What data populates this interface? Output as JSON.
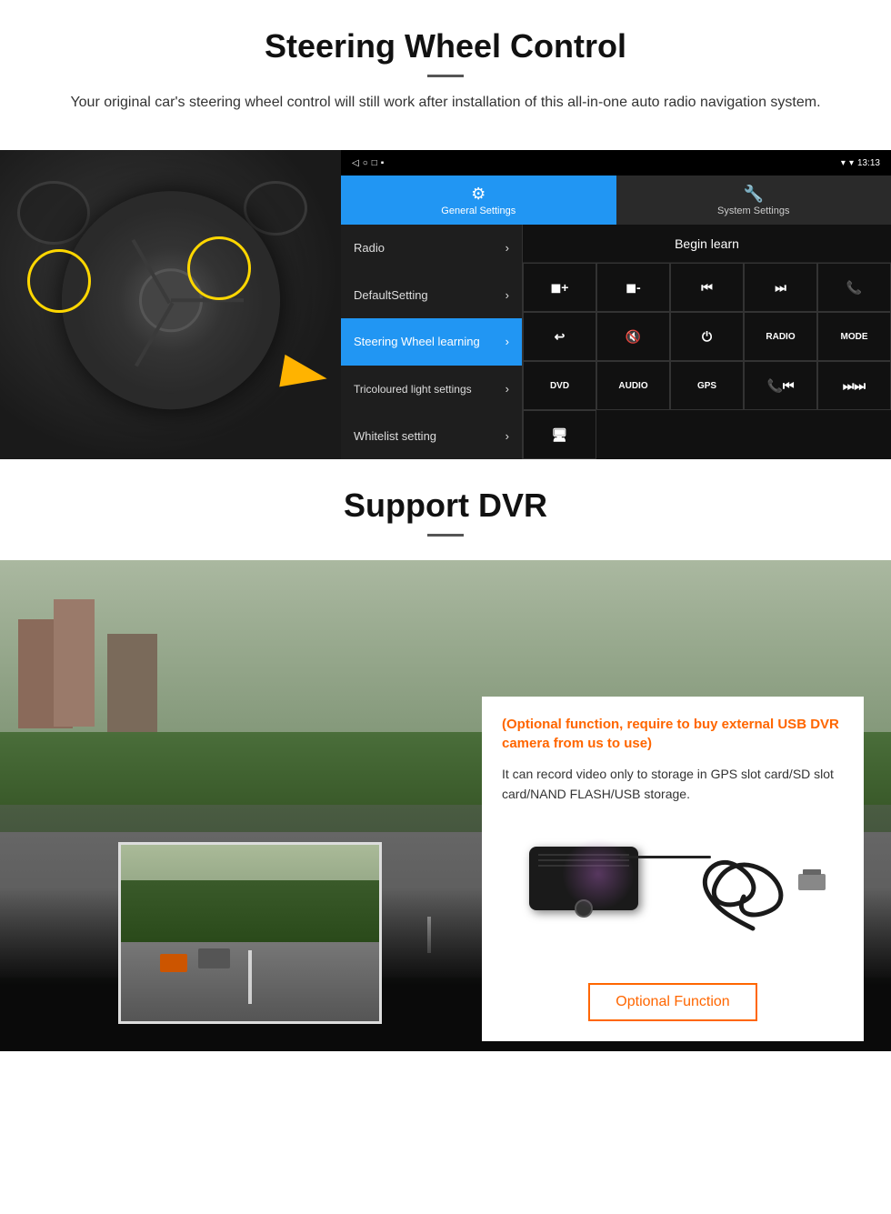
{
  "steering": {
    "title": "Steering Wheel Control",
    "subtitle": "Your original car's steering wheel control will still work after installation of this all-in-one auto radio navigation system.",
    "tabs": [
      {
        "label": "General Settings",
        "icon": "⚙"
      },
      {
        "label": "System Settings",
        "icon": "🔧"
      }
    ],
    "menu_items": [
      {
        "label": "Radio",
        "active": false
      },
      {
        "label": "DefaultSetting",
        "active": false
      },
      {
        "label": "Steering Wheel learning",
        "active": true
      },
      {
        "label": "Tricoloured light settings",
        "active": false
      },
      {
        "label": "Whitelist setting",
        "active": false
      }
    ],
    "begin_learn_label": "Begin learn",
    "status_time": "13:13",
    "control_buttons": [
      [
        "▐+",
        "▐-",
        "⏮",
        "⏭",
        "📞"
      ],
      [
        "↩",
        "🔇",
        "⏻",
        "RADIO",
        "MODE"
      ],
      [
        "DVD",
        "AUDIO",
        "GPS",
        "📞⏮",
        "⏭⏮"
      ]
    ]
  },
  "dvr": {
    "title": "Support DVR",
    "optional_text": "(Optional function, require to buy external USB DVR camera from us to use)",
    "description": "It can record video only to storage in GPS slot card/SD slot card/NAND FLASH/USB storage.",
    "optional_function_label": "Optional Function"
  }
}
